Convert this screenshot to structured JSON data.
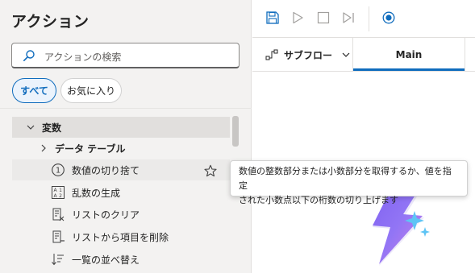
{
  "panel": {
    "title": "アクション",
    "search_placeholder": "アクションの検索",
    "filters": {
      "all": "すべて",
      "favorites": "お気に入り"
    }
  },
  "tree": {
    "category": "変数",
    "subcategory": "データ テーブル",
    "items": [
      {
        "label": "数値の切り捨て",
        "icon": "number-circle-icon"
      },
      {
        "label": "乱数の生成",
        "icon": "random-grid-icon"
      },
      {
        "label": "リストのクリア",
        "icon": "list-clear-icon"
      },
      {
        "label": "リストから項目を削除",
        "icon": "list-remove-icon"
      },
      {
        "label": "一覧の並べ替え",
        "icon": "sort-list-icon"
      }
    ]
  },
  "tooltip": {
    "line1": "数値の整数部分または小数部分を取得するか、値を指定",
    "line2": "された小数点以下の桁数の切り上げます"
  },
  "tabs": {
    "subflow_label": "サブフロー",
    "main_label": "Main"
  },
  "colors": {
    "accent": "#0f6cbd",
    "panel_bg": "#f3f2f1",
    "selected_row": "#e1dfdd"
  }
}
